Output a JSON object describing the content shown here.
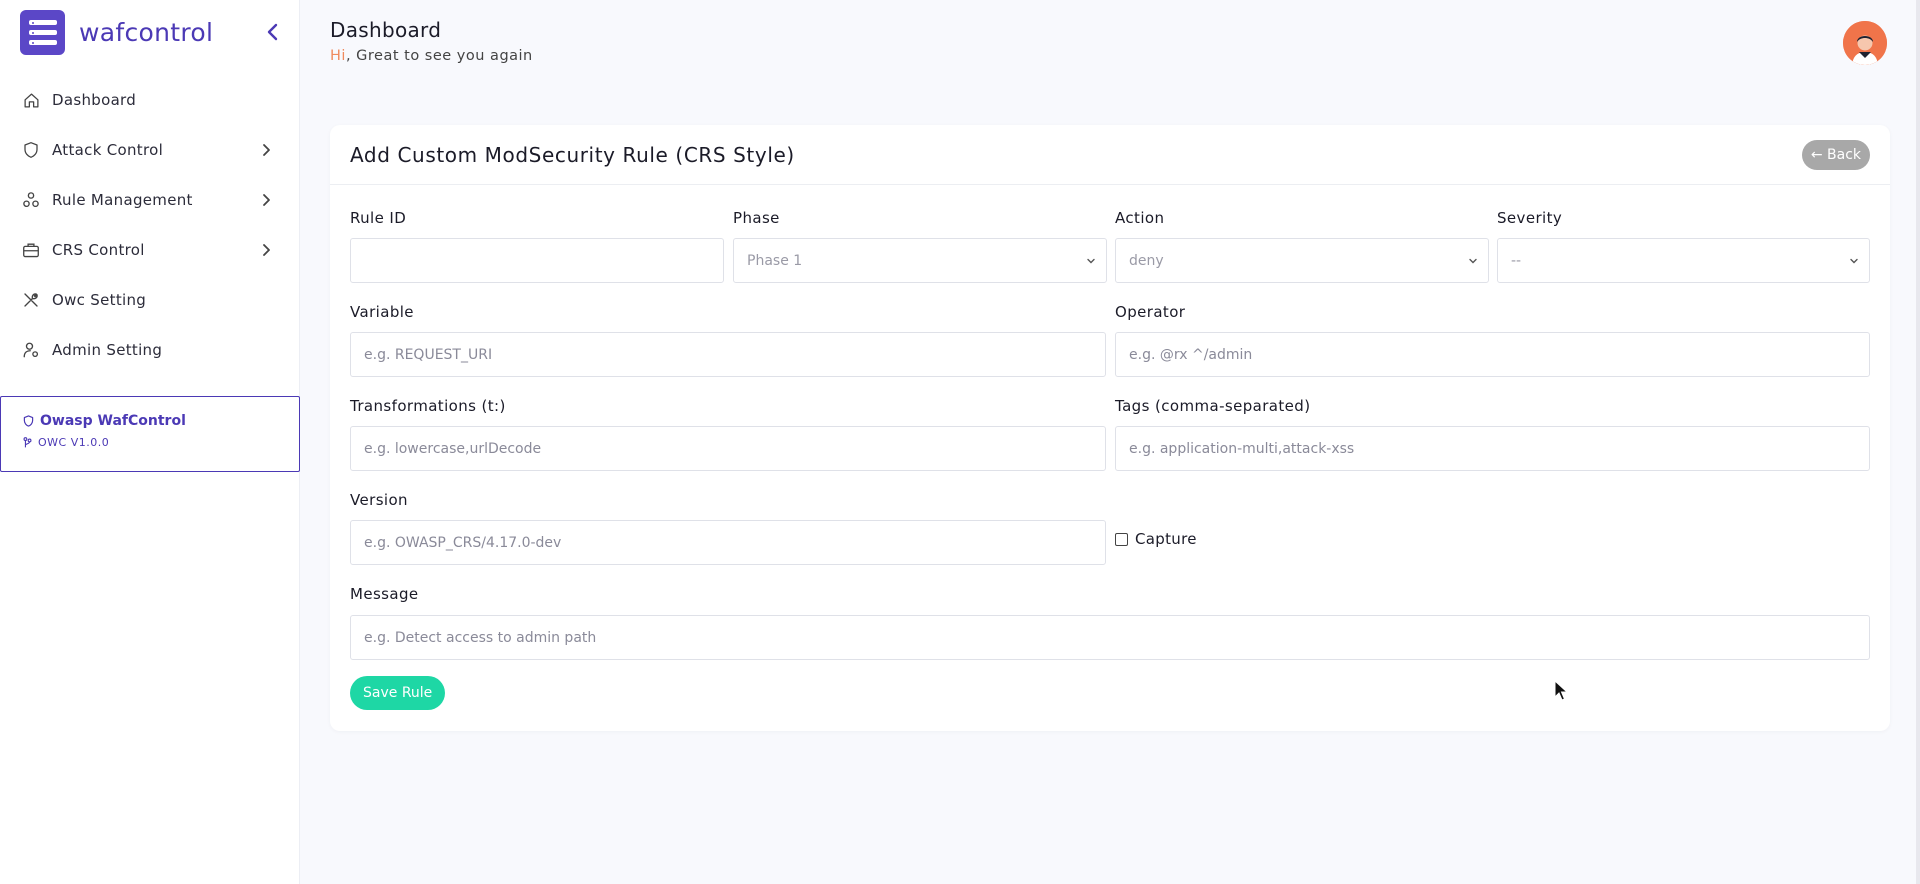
{
  "sidebar": {
    "brand": "wafcontrol",
    "items": [
      {
        "label": "Dashboard",
        "icon": "home-icon",
        "has_chevron": false
      },
      {
        "label": "Attack Control",
        "icon": "shield-icon",
        "has_chevron": true
      },
      {
        "label": "Rule Management",
        "icon": "nodes-icon",
        "has_chevron": true
      },
      {
        "label": "CRS Control",
        "icon": "briefcase-icon",
        "has_chevron": true
      },
      {
        "label": "Owc Setting",
        "icon": "tools-icon",
        "has_chevron": false
      },
      {
        "label": "Admin Setting",
        "icon": "user-gear-icon",
        "has_chevron": false
      }
    ],
    "version_card": {
      "title": "Owasp WafControl",
      "version": "OWC V1.0.0"
    }
  },
  "header": {
    "title": "Dashboard",
    "greeting_hi": "Hi",
    "greeting_rest": ", Great to see you again"
  },
  "form": {
    "title": "Add Custom ModSecurity Rule (CRS Style)",
    "back_label": "← Back",
    "rule_id": {
      "label": "Rule ID",
      "value": "",
      "placeholder": ""
    },
    "phase": {
      "label": "Phase",
      "selected": "Phase 1"
    },
    "action": {
      "label": "Action",
      "selected": "deny"
    },
    "severity": {
      "label": "Severity",
      "selected": "--"
    },
    "variable": {
      "label": "Variable",
      "placeholder": "e.g. REQUEST_URI"
    },
    "operator": {
      "label": "Operator",
      "placeholder": "e.g. @rx ^/admin"
    },
    "transformations": {
      "label": "Transformations (t:)",
      "placeholder": "e.g. lowercase,urlDecode"
    },
    "tags": {
      "label": "Tags (comma-separated)",
      "placeholder": "e.g. application-multi,attack-xss"
    },
    "version": {
      "label": "Version",
      "placeholder": "e.g. OWASP_CRS/4.17.0-dev"
    },
    "capture": {
      "label": "Capture",
      "checked": false
    },
    "message": {
      "label": "Message",
      "placeholder": "e.g. Detect access to admin path"
    },
    "save_label": "Save Rule"
  },
  "colors": {
    "accent": "#4b39b5",
    "save": "#1ed7a5",
    "back": "#a8a8a8",
    "greeting_hi": "#f08a5d",
    "avatar": "#f0744a"
  }
}
